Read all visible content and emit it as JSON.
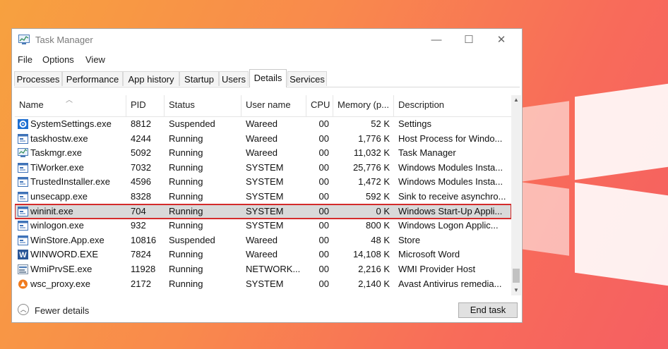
{
  "window": {
    "title": "Task Manager",
    "controls": {
      "minimize": "—",
      "maximize": "☐",
      "close": "✕"
    }
  },
  "menu": [
    "File",
    "Options",
    "View"
  ],
  "tabs": [
    "Processes",
    "Performance",
    "App history",
    "Startup",
    "Users",
    "Details",
    "Services"
  ],
  "active_tab": "Details",
  "columns": {
    "name": "Name",
    "pid": "PID",
    "status": "Status",
    "user": "User name",
    "cpu": "CPU",
    "memory": "Memory (p...",
    "description": "Description"
  },
  "rows": [
    {
      "name": "SystemSettings.exe",
      "pid": "8812",
      "status": "Suspended",
      "user": "Wareed",
      "cpu": "00",
      "memory": "52 K",
      "description": "Settings",
      "icon": "gear-icon"
    },
    {
      "name": "taskhostw.exe",
      "pid": "4244",
      "status": "Running",
      "user": "Wareed",
      "cpu": "00",
      "memory": "1,776 K",
      "description": "Host Process for Windo...",
      "icon": "window-icon"
    },
    {
      "name": "Taskmgr.exe",
      "pid": "5092",
      "status": "Running",
      "user": "Wareed",
      "cpu": "00",
      "memory": "11,032 K",
      "description": "Task Manager",
      "icon": "task-manager-icon"
    },
    {
      "name": "TiWorker.exe",
      "pid": "7032",
      "status": "Running",
      "user": "SYSTEM",
      "cpu": "00",
      "memory": "25,776 K",
      "description": "Windows Modules Insta...",
      "icon": "window-icon"
    },
    {
      "name": "TrustedInstaller.exe",
      "pid": "4596",
      "status": "Running",
      "user": "SYSTEM",
      "cpu": "00",
      "memory": "1,472 K",
      "description": "Windows Modules Insta...",
      "icon": "window-icon"
    },
    {
      "name": "unsecapp.exe",
      "pid": "8328",
      "status": "Running",
      "user": "SYSTEM",
      "cpu": "00",
      "memory": "592 K",
      "description": "Sink to receive asynchro...",
      "icon": "window-icon"
    },
    {
      "name": "wininit.exe",
      "pid": "704",
      "status": "Running",
      "user": "SYSTEM",
      "cpu": "00",
      "memory": "0 K",
      "description": "Windows Start-Up Appli...",
      "icon": "window-icon",
      "selected": true
    },
    {
      "name": "winlogon.exe",
      "pid": "932",
      "status": "Running",
      "user": "SYSTEM",
      "cpu": "00",
      "memory": "800 K",
      "description": "Windows Logon Applic...",
      "icon": "window-icon"
    },
    {
      "name": "WinStore.App.exe",
      "pid": "10816",
      "status": "Suspended",
      "user": "Wareed",
      "cpu": "00",
      "memory": "48 K",
      "description": "Store",
      "icon": "window-icon"
    },
    {
      "name": "WINWORD.EXE",
      "pid": "7824",
      "status": "Running",
      "user": "Wareed",
      "cpu": "00",
      "memory": "14,108 K",
      "description": "Microsoft Word",
      "icon": "word-icon"
    },
    {
      "name": "WmiPrvSE.exe",
      "pid": "11928",
      "status": "Running",
      "user": "NETWORK...",
      "cpu": "00",
      "memory": "2,216 K",
      "description": "WMI Provider Host",
      "icon": "wmi-icon"
    },
    {
      "name": "wsc_proxy.exe",
      "pid": "2172",
      "status": "Running",
      "user": "SYSTEM",
      "cpu": "00",
      "memory": "2,140 K",
      "description": "Avast Antivirus  remedia...",
      "icon": "avast-icon"
    }
  ],
  "footer": {
    "fewer_details": "Fewer details",
    "end_task": "End task"
  },
  "colors": {
    "selection_outline": "#d42b2b",
    "selection_fill": "#d9d9d9",
    "word_blue": "#2b5797",
    "avast_orange": "#f07b1e"
  }
}
